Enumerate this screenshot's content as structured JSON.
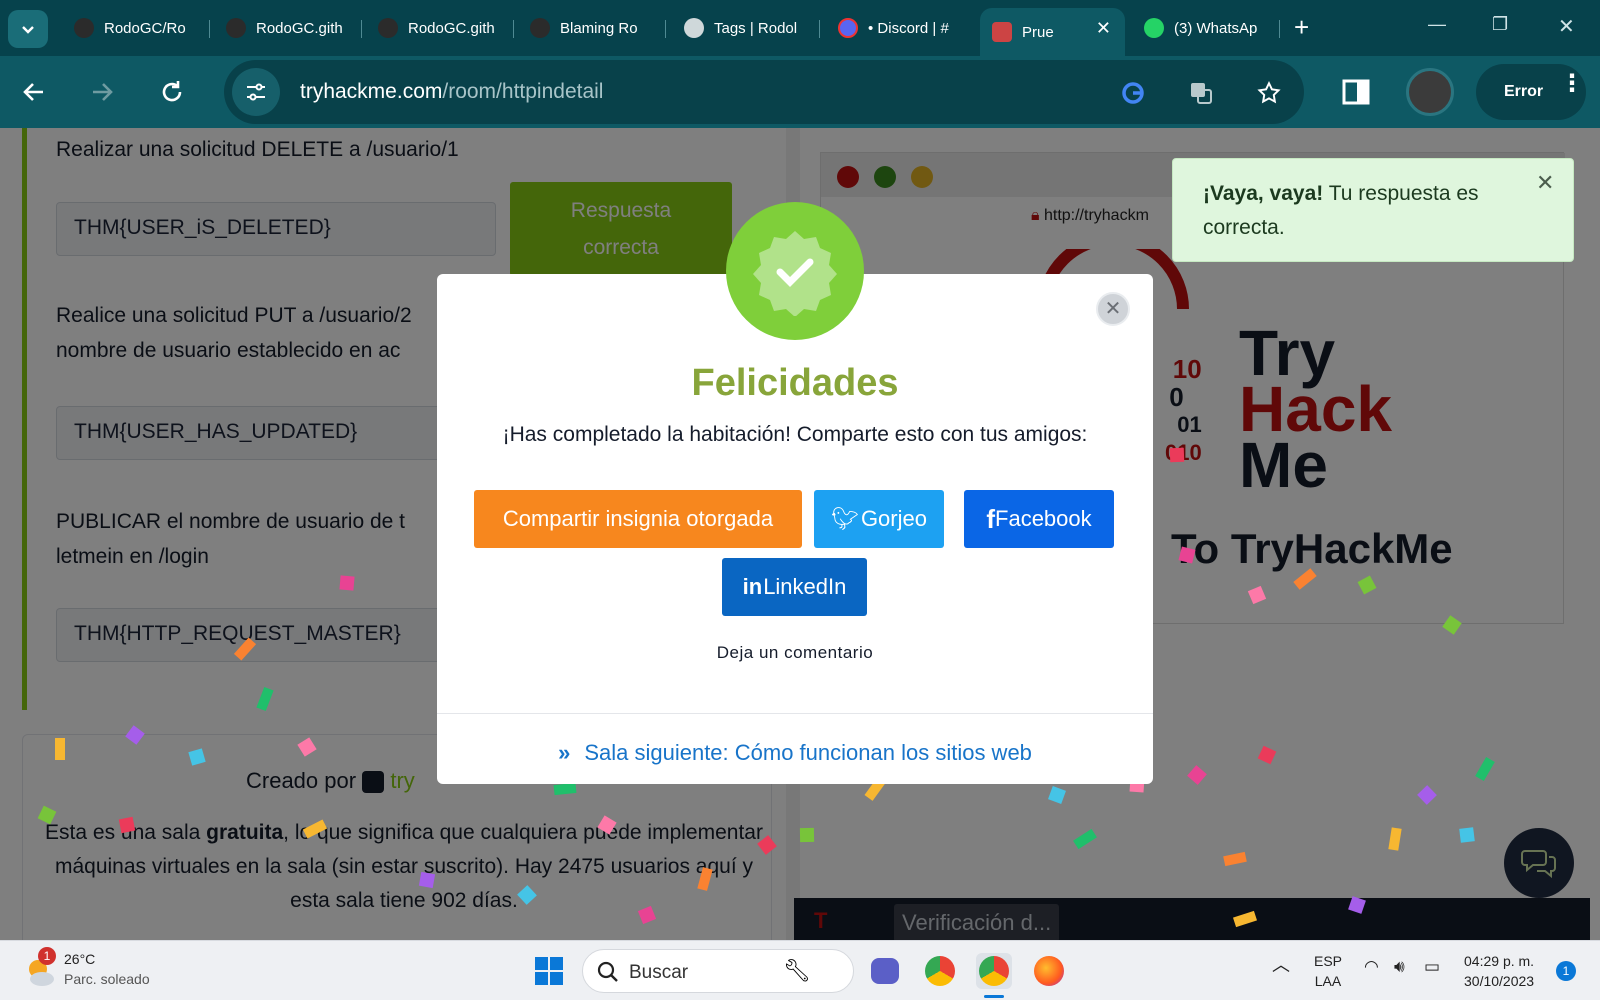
{
  "browser": {
    "tabs": [
      {
        "label": "RodoGC/Ro",
        "favicon": "github-icon"
      },
      {
        "label": "RodoGC.gith",
        "favicon": "github-icon"
      },
      {
        "label": "RodoGC.gith",
        "favicon": "github-icon"
      },
      {
        "label": "Blaming Ro",
        "favicon": "github-icon"
      },
      {
        "label": "Tags | Rodol",
        "favicon": "globe-icon"
      },
      {
        "label": "• Discord | #",
        "favicon": "discord-icon"
      },
      {
        "label": "Prue",
        "favicon": "tryhackme-icon"
      },
      {
        "label": "(3) WhatsAp",
        "favicon": "whatsapp-icon"
      }
    ],
    "url_host": "tryhackme.com",
    "url_path": "/room/httpindetail",
    "profile_button": "Error"
  },
  "room": {
    "questions": [
      {
        "text": "Realizar una solicitud DELETE a /usuario/1",
        "answer": "THM{USER_iS_DELETED}"
      },
      {
        "text": "Realice una solicitud PUT a /usuario/2 ... nombre de usuario establecido en ac",
        "line1": "Realice una solicitud PUT a /usuario/2",
        "line2": "nombre de usuario establecido en ac",
        "answer": "THM{USER_HAS_UPDATED}"
      },
      {
        "text": "PUBLICAR el nombre de usuario de t letmein en /login",
        "line1": "PUBLICAR el nombre de usuario de t",
        "line2": "letmein en /login",
        "answer": "THM{HTTP_REQUEST_MASTER}"
      }
    ],
    "correct_button": [
      "Respuesta",
      "correcta"
    ],
    "created_by": "Creado por",
    "created_brand": "try",
    "desc_pre": "Esta es una sala ",
    "desc_bold": "gratuita",
    "desc_post": ", lo que significa que cualquiera puede implementar máquinas virtuales en la sala (sin estar suscrito). Hay 2475 usuarios aquí y esta sala tiene 902 días."
  },
  "preview": {
    "mini_url": "http://tryhackm",
    "logo": {
      "try": "Try",
      "hack": "Hack",
      "me": "Me"
    },
    "nums": [
      "10",
      "0",
      "01",
      "010"
    ],
    "welcome": "To TryHackMe",
    "verification": "Verificación d..."
  },
  "modal": {
    "title": "Felicidades",
    "subtitle": "¡Has completado la habitación! Comparte esto con tus amigos:",
    "share_badge": "Compartir insignia otorgada",
    "twitter": "Gorjeo",
    "facebook": "Facebook",
    "linkedin": "LinkedIn",
    "comment": "Deja un comentario",
    "next_room": "Sala siguiente: Cómo funcionan los sitios web"
  },
  "toast": {
    "bold": "¡Vaya, vaya!",
    "text": " Tu respuesta es correcta."
  },
  "taskbar": {
    "weather_badge": "1",
    "temperature": "26°C",
    "weather": "Parc. soleado",
    "search_placeholder": "Buscar",
    "lang": "ESP",
    "lang2": "LAA",
    "time": "04:29 p. m.",
    "date": "30/10/2023",
    "notifications": "1"
  },
  "colors": {
    "thm_green": "#88cc14",
    "share_orange": "#f7871e",
    "twitter": "#1da1f2",
    "facebook": "#0a66e6",
    "linkedin": "#0a66c2",
    "chrome_teal": "#0e5964"
  }
}
